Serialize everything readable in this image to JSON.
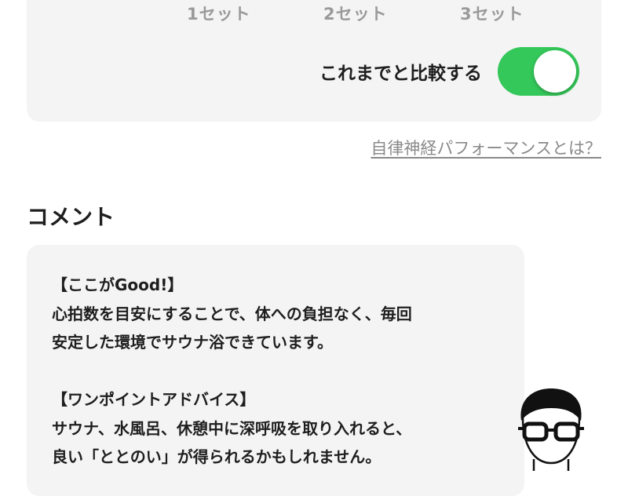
{
  "sets": {
    "set1": "1セット",
    "set2": "2セット",
    "set3": "3セット"
  },
  "compare": {
    "label": "これまでと比較する",
    "enabled": true,
    "toggle_color": "#34c759"
  },
  "help_link": "自律神経パフォーマンスとは？",
  "comment_section": {
    "title": "コメント",
    "good_heading": "【ここがGood!】",
    "good_line1": "心拍数を目安にすることで、体への負担なく、毎回",
    "good_line2": "安定した環境でサウナ浴できています。",
    "advice_heading": "【ワンポイントアドバイス】",
    "advice_line1": "サウナ、水風呂、休憩中に深呼吸を取り入れると、",
    "advice_line2": "良い「ととのい」が得られるかもしれません。"
  },
  "advisor_icon": "glasses-man-avatar"
}
